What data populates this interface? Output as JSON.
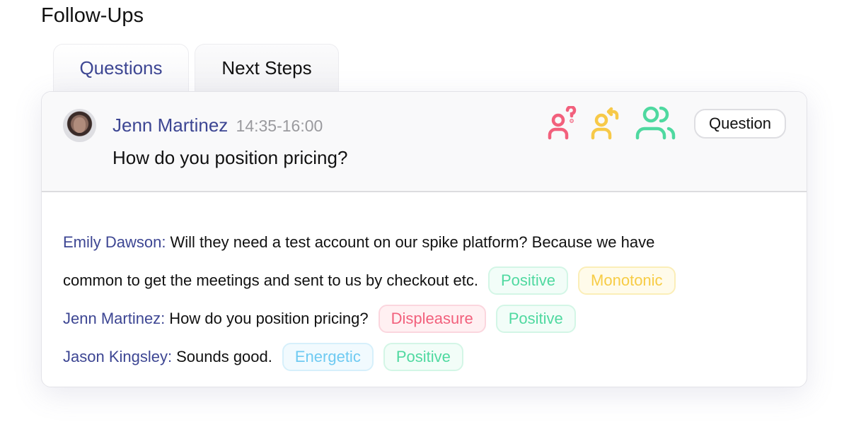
{
  "section_title": "Follow-Ups",
  "tabs": [
    {
      "label": "Questions",
      "active": true
    },
    {
      "label": "Next Steps",
      "active": false
    }
  ],
  "header": {
    "speaker": "Jenn Martinez",
    "time_range": "14:35-16:00",
    "question": "How do you position pricing?",
    "icons": [
      {
        "name": "user-question-icon",
        "color": "#f2607c"
      },
      {
        "name": "user-reply-icon",
        "color": "#f7c948"
      },
      {
        "name": "users-group-icon",
        "color": "#4fd9a0"
      }
    ],
    "type_badge": "Question"
  },
  "transcript": [
    {
      "speaker": "Emily Dawson:",
      "text_line1": "Will they need a test account on our spike platform? Because we have",
      "text_line2": "common to get the meetings and sent to us by checkout etc.",
      "tags": [
        "Positive",
        "Monotonic"
      ]
    },
    {
      "speaker": "Jenn Martinez:",
      "text": "How do you position pricing?",
      "tags": [
        "Displeasure",
        "Positive"
      ]
    },
    {
      "speaker": "Jason Kingsley:",
      "text": "Sounds good.",
      "tags": [
        "Energetic",
        "Positive"
      ]
    }
  ],
  "colors": {
    "accent": "#3d4693",
    "positive": "#4fd9a0",
    "monotonic": "#f7cc45",
    "displeasure": "#f2607c",
    "energetic": "#6ecaf2"
  }
}
